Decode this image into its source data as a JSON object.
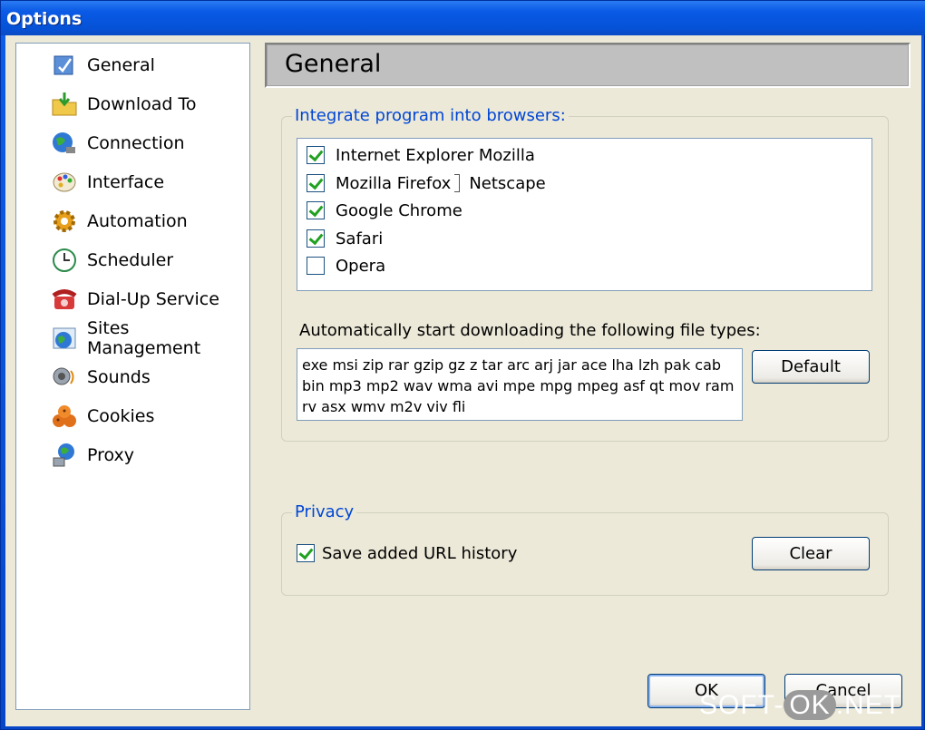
{
  "window": {
    "title": "Options"
  },
  "sidebar": {
    "items": [
      {
        "label": "General",
        "icon": "general-icon"
      },
      {
        "label": "Download To",
        "icon": "download-folder-icon"
      },
      {
        "label": "Connection",
        "icon": "connection-globe-icon"
      },
      {
        "label": "Interface",
        "icon": "palette-icon"
      },
      {
        "label": "Automation",
        "icon": "automation-gear-icon"
      },
      {
        "label": "Scheduler",
        "icon": "clock-icon"
      },
      {
        "label": "Dial-Up Service",
        "icon": "phone-icon"
      },
      {
        "label": "Sites Management",
        "icon": "sites-globe-icon"
      },
      {
        "label": "Sounds",
        "icon": "speaker-icon"
      },
      {
        "label": "Cookies",
        "icon": "cookies-icon"
      },
      {
        "label": "Proxy",
        "icon": "proxy-icon"
      }
    ]
  },
  "header": {
    "title": "General"
  },
  "integrate": {
    "legend": "Integrate program into browsers:",
    "browsers": [
      {
        "label": "Internet Explorer Mozilla",
        "checked": true
      },
      {
        "label": "Mozilla Firefox",
        "extra": "Netscape",
        "checked": true
      },
      {
        "label": "Google Chrome",
        "checked": true
      },
      {
        "label": "Safari",
        "checked": true
      },
      {
        "label": "Opera",
        "checked": false
      }
    ],
    "filetypes_label": "Automatically start downloading the following file types:",
    "filetypes_value": "exe msi zip rar gzip gz z tar arc arj jar ace lha lzh pak cab bin mp3 mp2 wav wma avi mpe mpg mpeg asf qt mov ram rv asx wmv m2v viv fli",
    "default_button": "Default"
  },
  "privacy": {
    "legend": "Privacy",
    "save_history_label": "Save added URL history",
    "save_history_checked": true,
    "clear_button": "Clear"
  },
  "footer": {
    "ok_button": "OK",
    "cancel_button": "Cancel"
  },
  "watermark": {
    "left": "SOFT-",
    "ok": "OK",
    "right": ".NET"
  },
  "colors": {
    "accent": "#0046d5",
    "check": "#21a121",
    "face": "#ece9d8"
  }
}
